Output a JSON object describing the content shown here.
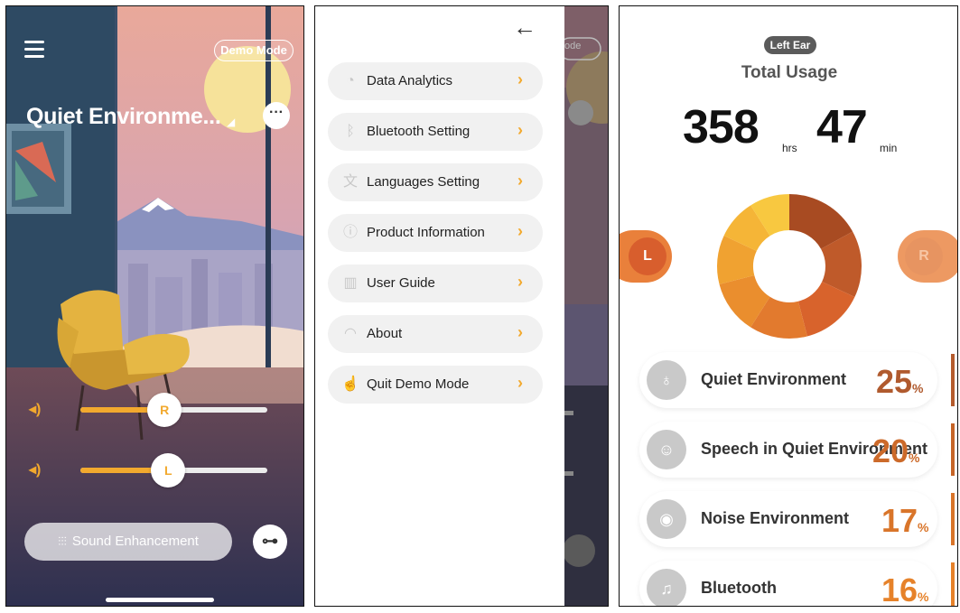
{
  "screen1": {
    "demo_badge": "Demo Mode",
    "title": "Quiet Environme...",
    "right_channel_label": "R",
    "left_channel_label": "L",
    "right_volume": 0.45,
    "left_volume": 0.47,
    "sound_enhancement_label": "Sound Enhancement",
    "icons": [
      "hamburger-icon",
      "more-icon",
      "volume-icon",
      "equalizer-icon",
      "toggle-icon"
    ]
  },
  "screen2": {
    "menu_items": [
      {
        "label": "Data Analytics",
        "icon": "analytics-icon"
      },
      {
        "label": "Bluetooth Setting",
        "icon": "bluetooth-icon"
      },
      {
        "label": "Languages Setting",
        "icon": "language-icon"
      },
      {
        "label": "Product Information",
        "icon": "info-icon"
      },
      {
        "label": "User Guide",
        "icon": "book-icon"
      },
      {
        "label": "About",
        "icon": "headset-icon"
      },
      {
        "label": "Quit Demo Mode",
        "icon": "hand-icon"
      }
    ],
    "peek_badge": "ode"
  },
  "screen3": {
    "ear_badge": "Left Ear",
    "title": "Total Usage",
    "hours": "358",
    "hours_unit": "hrs",
    "minutes": "47",
    "minutes_unit": "min",
    "left_tab": "L",
    "right_tab": "R",
    "donut_colors": [
      "#a84b22",
      "#bf5a2a",
      "#d8632c",
      "#e27a2e",
      "#ea8e2e",
      "#f0a231",
      "#f5b537",
      "#f8c840"
    ],
    "donut_values": [
      17,
      15,
      14,
      13,
      12,
      11,
      9,
      9
    ],
    "items": [
      {
        "label": "Quiet Environment",
        "pct": "25",
        "color": "#b05a2e",
        "icon": "ear-icon"
      },
      {
        "label": "Speech in Quiet Environment",
        "pct": "20",
        "color": "#cc6a2a",
        "icon": "speech-icon"
      },
      {
        "label": "Noise Environment",
        "pct": "17",
        "color": "#d9752a",
        "icon": "noise-icon"
      },
      {
        "label": "Bluetooth",
        "pct": "16",
        "color": "#e6822a",
        "icon": "music-icon"
      }
    ],
    "pct_symbol": "%"
  }
}
